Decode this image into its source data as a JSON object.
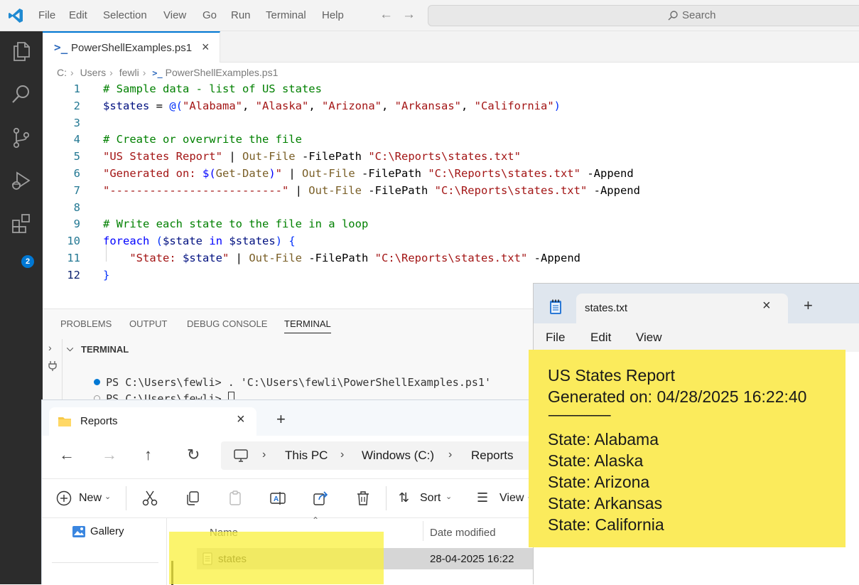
{
  "vscode": {
    "menu": [
      "File",
      "Edit",
      "Selection",
      "View",
      "Go",
      "Run",
      "Terminal",
      "Help"
    ],
    "search_label": "Search",
    "extensions_badge": "2",
    "tab_title": "PowerShellExamples.ps1",
    "breadcrumb": [
      "C:",
      "Users",
      "fewli",
      "PowerShellExamples.ps1"
    ],
    "code_lines": [
      "# Sample data - list of US states",
      "$states = @(\"Alabama\", \"Alaska\", \"Arizona\", \"Arkansas\", \"California\")",
      "",
      "# Create or overwrite the file",
      "\"US States Report\" | Out-File -FilePath \"C:\\Reports\\states.txt\"",
      "\"Generated on: $(Get-Date)\" | Out-File -FilePath \"C:\\Reports\\states.txt\" -Append",
      "\"--------------------------\" | Out-File -FilePath \"C:\\Reports\\states.txt\" -Append",
      "",
      "# Write each state to the file in a loop",
      "foreach ($state in $states) {",
      "    \"State: $state\" | Out-File -FilePath \"C:\\Reports\\states.txt\" -Append",
      "}"
    ],
    "panel_tabs": [
      "PROBLEMS",
      "OUTPUT",
      "DEBUG CONSOLE",
      "TERMINAL"
    ],
    "terminal_header": "TERMINAL",
    "terminal_lines": [
      "PS C:\\Users\\fewli> . 'C:\\Users\\fewli\\PowerShellExamples.ps1'",
      "PS C:\\Users\\fewli> "
    ]
  },
  "explorer": {
    "tab_title": "Reports",
    "address": [
      "This PC",
      "Windows (C:)",
      "Reports"
    ],
    "toolbar": {
      "new_label": "New",
      "sort_label": "Sort",
      "view_label": "View"
    },
    "sidebar_item": "Gallery",
    "columns": [
      "Name",
      "Date modified"
    ],
    "files": [
      {
        "name": "states",
        "date_modified": "28-04-2025 16:22"
      }
    ]
  },
  "notepad": {
    "tab_title": "states.txt",
    "menu": [
      "File",
      "Edit",
      "View"
    ],
    "content_lines": [
      "US States Report",
      "Generated on: 04/28/2025 16:22:40",
      "--------------------------",
      "State: Alabama",
      "State: Alaska",
      "State: Arizona",
      "State: Arkansas",
      "State: California"
    ]
  },
  "colors": {
    "highlight": "#fbeb5c",
    "vscode_accent": "#0078d4",
    "activity_bar": "#2c2c2c"
  }
}
